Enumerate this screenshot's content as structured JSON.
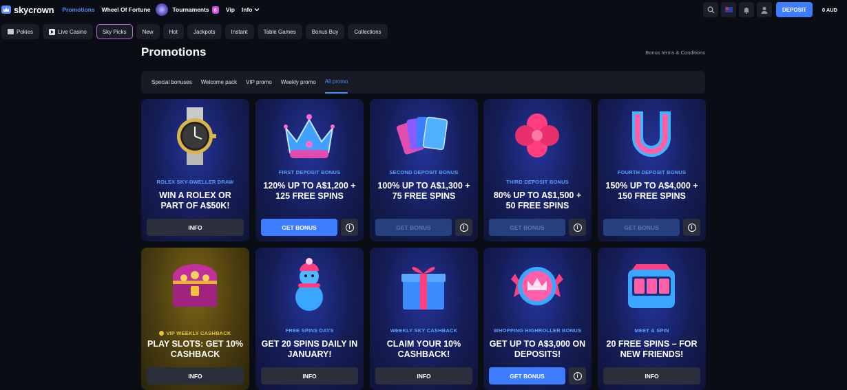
{
  "brand": {
    "name": "skycrown"
  },
  "nav": {
    "promotions": "Promotions",
    "wheel": "Wheel Of Fortune",
    "tournaments": "Tournaments",
    "tournaments_badge": "6",
    "vip": "Vip",
    "info": "Info"
  },
  "header": {
    "deposit": "DEPOSIT",
    "balance": "0 AUD"
  },
  "categories": [
    "Pokies",
    "Live Casino",
    "Sky Picks",
    "New",
    "Hot",
    "Jackpots",
    "Instant",
    "Table Games",
    "Bonus Buy",
    "Collections"
  ],
  "selected_category": "Sky Picks",
  "page": {
    "title": "Promotions",
    "terms": "Bonus terms & Conditions"
  },
  "tabs": [
    "Special bonuses",
    "Welcome pack",
    "VIP promo",
    "Weekly promo",
    "All promo"
  ],
  "active_tab": "All promo",
  "cards": [
    {
      "image": "rolex-watch",
      "subtitle": "ROLEX SKY-DWELLER DRAW",
      "headline": "WIN A ROLEX OR PART OF A$50K!",
      "button": "INFO"
    },
    {
      "image": "crown",
      "subtitle": "FIRST DEPOSIT BONUS",
      "headline": "120% UP TO A$1,200 + 125 FREE SPINS",
      "button": "GET BONUS"
    },
    {
      "image": "playing-cards",
      "subtitle": "SECOND DEPOSIT BONUS",
      "headline": "100% UP TO A$1,300 + 75 FREE SPINS",
      "button": "GET BONUS"
    },
    {
      "image": "four-leaf-clover",
      "subtitle": "THIRD DEPOSIT BONUS",
      "headline": "80% UP TO A$1,500 + 50 FREE SPINS",
      "button": "GET BONUS"
    },
    {
      "image": "horseshoe",
      "subtitle": "FOURTH DEPOSIT BONUS",
      "headline": "150% UP TO A$4,000 + 150 FREE SPINS",
      "button": "GET BONUS"
    },
    {
      "image": "treasure-chest",
      "subtitle": "VIP WEEKLY CASHBACK",
      "headline": "PLAY SLOTS: GET 10% CASHBACK",
      "button": "INFO"
    },
    {
      "image": "snowman-bird",
      "subtitle": "FREE SPINS DAYS",
      "headline": "GET 20 SPINS DAILY IN JANUARY!",
      "button": "INFO"
    },
    {
      "image": "gift-box",
      "subtitle": "WEEKLY SKY CASHBACK",
      "headline": "CLAIM YOUR 10% CASHBACK!",
      "button": "INFO"
    },
    {
      "image": "crown-badge",
      "subtitle": "WHOPPING HIGHROLLER BONUS",
      "headline": "GET UP TO A$3,000 ON DEPOSITS!",
      "button": "GET BONUS"
    },
    {
      "image": "slot-machine",
      "subtitle": "MEET & SPIN",
      "headline": "20 FREE SPINS – FOR NEW FRIENDS!",
      "button": "INFO"
    }
  ],
  "colors": {
    "accent": "#3d7bff",
    "background": "#0b0d14",
    "vip_gold": "#f2c33a"
  }
}
